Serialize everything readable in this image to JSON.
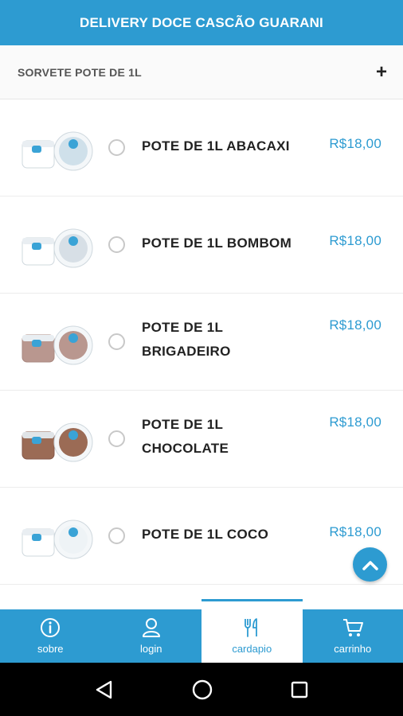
{
  "header": {
    "title": "DELIVERY DOCE CASCÃO GUARANI"
  },
  "category": {
    "title": "SORVETE POTE DE 1L",
    "toggle_icon": "plus-icon",
    "toggle_label": "+"
  },
  "products": [
    {
      "name": "POTE DE 1L ABACAXI",
      "price": "R$18,00",
      "tint": "#cfe0ea"
    },
    {
      "name": "POTE DE 1L BOMBOM",
      "price": "R$18,00",
      "tint": "#d7dfe6"
    },
    {
      "name": "POTE DE 1L BRIGADEIRO",
      "price": "R$18,00",
      "tint": "#b9978f"
    },
    {
      "name": "POTE DE 1L CHOCOLATE",
      "price": "R$18,00",
      "tint": "#9b6b55"
    },
    {
      "name": "POTE DE 1L COCO",
      "price": "R$18,00",
      "tint": "#eef3f6"
    }
  ],
  "nav": {
    "sobre": "sobre",
    "login": "login",
    "cardapio": "cardapio",
    "carrinho": "carrinho"
  },
  "colors": {
    "brand": "#2d9bd1",
    "text": "#222222"
  },
  "icons": [
    "plus-icon",
    "chevron-up-icon",
    "info-icon",
    "user-icon",
    "cutlery-icon",
    "cart-icon",
    "back-icon",
    "home-icon",
    "recents-icon"
  ]
}
